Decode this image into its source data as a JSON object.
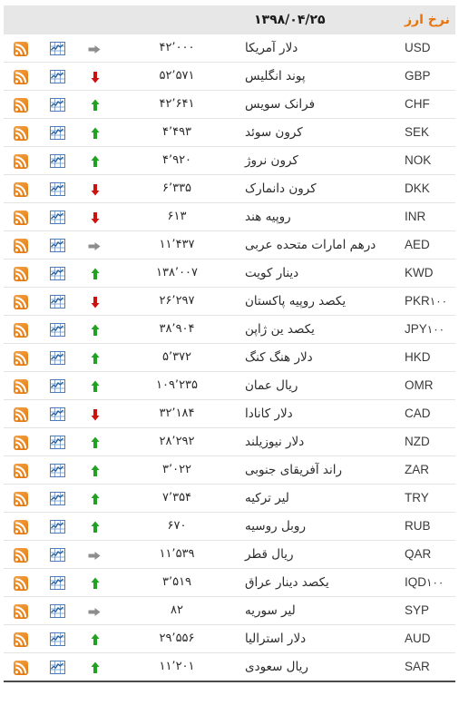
{
  "header": {
    "title": "نرخ ارز",
    "date": "۱۳۹۸/۰۴/۲۵",
    "title_color": "#e8730c"
  },
  "icons": {
    "rss": "rss-icon",
    "chart": "chart-icon",
    "up": "arrow-up-icon",
    "down": "arrow-down-icon",
    "flat": "arrow-right-icon"
  },
  "colors": {
    "up": "#21a121",
    "down": "#cc1111",
    "flat": "#8d8d8d",
    "header_bg": "#e7e7e7",
    "row_border": "#e3e3e3",
    "rss_orange": "#ec8b24",
    "chart_blue": "#4a7ebb"
  },
  "rows": [
    {
      "code": "USD",
      "mult": "",
      "name": "دلار آمریکا",
      "rate": "۴۲٬۰۰۰",
      "trend": "flat"
    },
    {
      "code": "GBP",
      "mult": "",
      "name": "پوند انگلیس",
      "rate": "۵۲٬۵۷۱",
      "trend": "down"
    },
    {
      "code": "CHF",
      "mult": "",
      "name": "فرانک سویس",
      "rate": "۴۲٬۶۴۱",
      "trend": "up"
    },
    {
      "code": "SEK",
      "mult": "",
      "name": "کرون سوئد",
      "rate": "۴٬۴۹۳",
      "trend": "up"
    },
    {
      "code": "NOK",
      "mult": "",
      "name": "کرون نروژ",
      "rate": "۴٬۹۲۰",
      "trend": "up"
    },
    {
      "code": "DKK",
      "mult": "",
      "name": "کرون دانمارک",
      "rate": "۶٬۳۳۵",
      "trend": "down"
    },
    {
      "code": "INR",
      "mult": "",
      "name": "روپیه هند",
      "rate": "۶۱۳",
      "trend": "down"
    },
    {
      "code": "AED",
      "mult": "",
      "name": "درهم امارات متحده عربی",
      "rate": "۱۱٬۴۳۷",
      "trend": "flat"
    },
    {
      "code": "KWD",
      "mult": "",
      "name": "دینار کویت",
      "rate": "۱۳۸٬۰۰۷",
      "trend": "up"
    },
    {
      "code": "PKR",
      "mult": "۱۰۰",
      "name": "یکصد روپیه پاکستان",
      "rate": "۲۶٬۲۹۷",
      "trend": "down"
    },
    {
      "code": "JPY",
      "mult": "۱۰۰",
      "name": "یکصد ین ژاپن",
      "rate": "۳۸٬۹۰۴",
      "trend": "up"
    },
    {
      "code": "HKD",
      "mult": "",
      "name": "دلار هنگ کنگ",
      "rate": "۵٬۳۷۲",
      "trend": "up"
    },
    {
      "code": "OMR",
      "mult": "",
      "name": "ریال عمان",
      "rate": "۱۰۹٬۲۳۵",
      "trend": "up"
    },
    {
      "code": "CAD",
      "mult": "",
      "name": "دلار کانادا",
      "rate": "۳۲٬۱۸۴",
      "trend": "down"
    },
    {
      "code": "NZD",
      "mult": "",
      "name": "دلار نیوزیلند",
      "rate": "۲۸٬۲۹۲",
      "trend": "up"
    },
    {
      "code": "ZAR",
      "mult": "",
      "name": "راند آفریقای جنوبی",
      "rate": "۳٬۰۲۲",
      "trend": "up"
    },
    {
      "code": "TRY",
      "mult": "",
      "name": "لیر ترکیه",
      "rate": "۷٬۳۵۴",
      "trend": "up"
    },
    {
      "code": "RUB",
      "mult": "",
      "name": "روبل روسیه",
      "rate": "۶۷۰",
      "trend": "up"
    },
    {
      "code": "QAR",
      "mult": "",
      "name": "ریال قطر",
      "rate": "۱۱٬۵۳۹",
      "trend": "flat"
    },
    {
      "code": "IQD",
      "mult": "۱۰۰",
      "name": "یکصد دینار عراق",
      "rate": "۳٬۵۱۹",
      "trend": "up"
    },
    {
      "code": "SYP",
      "mult": "",
      "name": "لیر سوریه",
      "rate": "۸۲",
      "trend": "flat"
    },
    {
      "code": "AUD",
      "mult": "",
      "name": "دلار استرالیا",
      "rate": "۲۹٬۵۵۶",
      "trend": "up"
    },
    {
      "code": "SAR",
      "mult": "",
      "name": "ریال سعودی",
      "rate": "۱۱٬۲۰۱",
      "trend": "up"
    }
  ]
}
